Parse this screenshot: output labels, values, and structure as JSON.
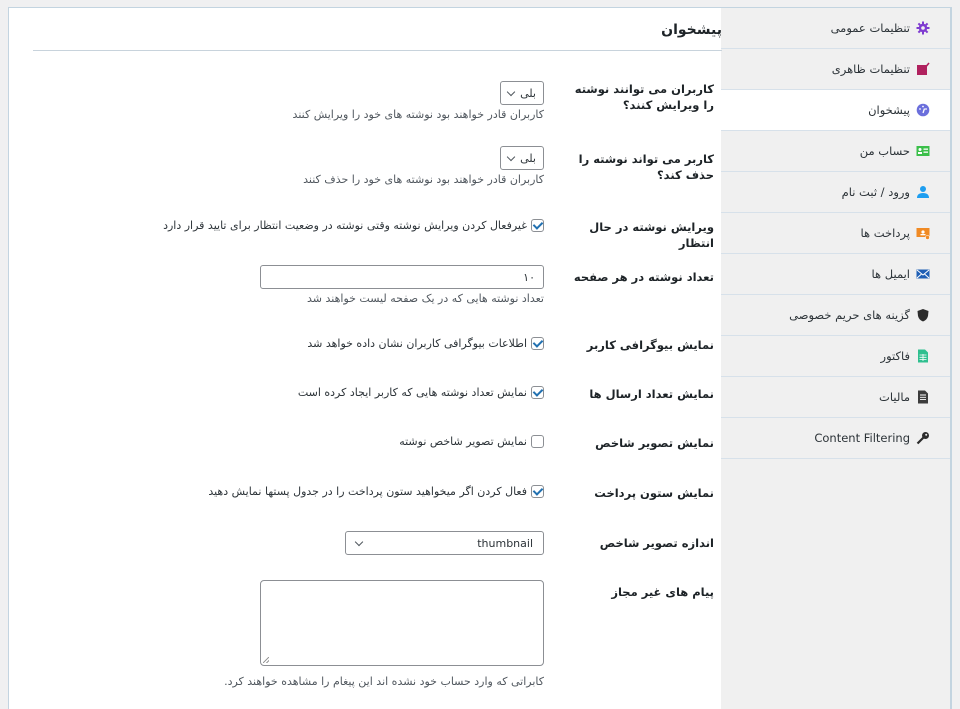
{
  "sidebar": {
    "items": [
      {
        "label": "تنظیمات عمومی",
        "icon": "gear-icon",
        "color": "#7e3bd0",
        "active": false
      },
      {
        "label": "تنظیمات ظاهری",
        "icon": "edit-icon",
        "color": "#b0215e",
        "active": false
      },
      {
        "label": "پیشخوان",
        "icon": "dashboard-icon",
        "color": "#6b6fdc",
        "active": true
      },
      {
        "label": "حساب من",
        "icon": "id-card-icon",
        "color": "#3bbf4a",
        "active": false
      },
      {
        "label": "ورود / ثبت نام",
        "icon": "user-icon",
        "color": "#1e9ef0",
        "active": false
      },
      {
        "label": "پرداخت ها",
        "icon": "payment-icon",
        "color": "#f08a24",
        "active": false
      },
      {
        "label": "ایمیل ها",
        "icon": "envelope-icon",
        "color": "#1f5fb5",
        "active": false
      },
      {
        "label": "گزینه های حریم خصوصی",
        "icon": "shield-icon",
        "color": "#2c2c2c",
        "active": false
      },
      {
        "label": "فاکتور",
        "icon": "spreadsheet-icon",
        "color": "#2fbf8f",
        "active": false
      },
      {
        "label": "مالیات",
        "icon": "document-icon",
        "color": "#3c3c3c",
        "active": false
      },
      {
        "label": "Content Filtering",
        "icon": "key-icon",
        "color": "#2c2c2c",
        "active": false
      }
    ]
  },
  "main": {
    "title": "پیشخوان",
    "settings": {
      "can_edit": {
        "label": "کاربران می توانند نوشته را ویرایش کنند؟",
        "value": "بلی",
        "description": "کاربران قادر خواهند بود نوشته های خود را ویرایش کنند"
      },
      "can_delete": {
        "label": "کاربر می تواند نوشته را حذف کند؟",
        "value": "بلی",
        "description": "کاربران قادر خواهند بود نوشته های خود را حذف کنند"
      },
      "pending_edit": {
        "label": "ویرایش نوشته در حال انتظار",
        "checked": true,
        "text": "غیرفعال کردن ویرایش نوشته وقتی نوشته در وضعیت انتظار برای تایید قرار دارد"
      },
      "posts_per_page": {
        "label": "تعداد نوشته در هر صفحه",
        "value": "۱۰",
        "description": "تعداد نوشته هایی که در یک صفحه لیست خواهند شد"
      },
      "show_bio": {
        "label": "نمایش بیوگرافی کاربر",
        "checked": true,
        "text": "اطلاعات بیوگرافی کاربران نشان داده خواهد شد"
      },
      "show_post_count": {
        "label": "نمایش تعداد ارسال ها",
        "checked": true,
        "text": "نمایش تعداد نوشته هایی که کاربر ایجاد کرده است"
      },
      "show_featured": {
        "label": "نمایش تصویر شاخص",
        "checked": false,
        "text": "نمایش تصویر شاخص نوشته"
      },
      "show_payment_col": {
        "label": "نمایش ستون پرداخت",
        "checked": true,
        "text": "فعال کردن اگر میخواهید ستون پرداخت را در جدول پستها نمایش دهید"
      },
      "featured_size": {
        "label": "اندازه تصویر شاخص",
        "value": "thumbnail"
      },
      "unauth_message": {
        "label": "پیام های غیر مجاز",
        "value": "",
        "description": "کابراتی که وارد حساب خود نشده اند این پیغام را مشاهده خواهند کرد."
      }
    }
  },
  "colors": {
    "accent": "#2271b1",
    "border": "#c3d4e0",
    "sidebar_bg": "#f0f0f0"
  }
}
